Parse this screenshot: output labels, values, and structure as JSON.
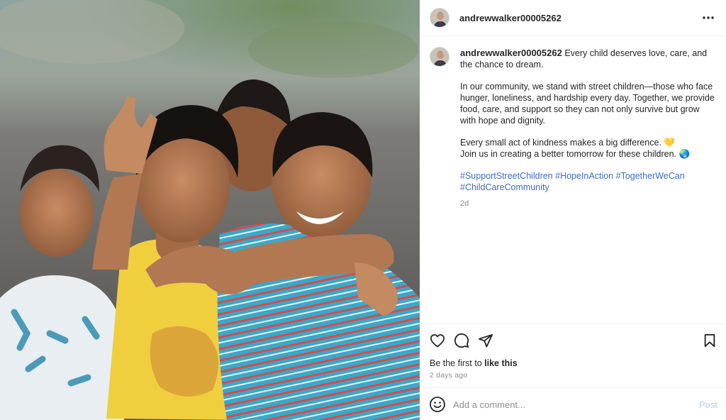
{
  "post": {
    "username": "andrewwalker00005262",
    "photo_description": "",
    "caption": {
      "username": "andrewwalker00005262",
      "line1": "Every child deserves love, care, and the chance to dream.",
      "para2": "In our community, we stand with street children—those who face hunger, loneliness, and hardship every day. Together, we provide food, care, and support so they can not only survive but grow with hope and dignity.",
      "line3": "Every small act of kindness makes a big difference. 💛",
      "line4": "Join us in creating a better tomorrow for these children. 🌏",
      "hashtags": [
        "#SupportStreetChildren",
        "#HopeInAction",
        "#TogetherWeCan",
        "#ChildCareCommunity"
      ],
      "time": "2d"
    },
    "likes": {
      "prefix": "Be the first to ",
      "emphasis": "like this"
    },
    "posted_ago": "2 days ago",
    "comment_placeholder": "Add a comment...",
    "post_button": "Post"
  },
  "icons": {
    "more": "more-options-icon",
    "like": "heart-icon",
    "comment": "comment-icon",
    "share": "send-icon",
    "save": "bookmark-icon",
    "emoji": "emoji-icon"
  },
  "colors": {
    "hashtag": "#3f6cc7",
    "post_button": "#b2cdf5",
    "muted": "#8e8e8e"
  }
}
